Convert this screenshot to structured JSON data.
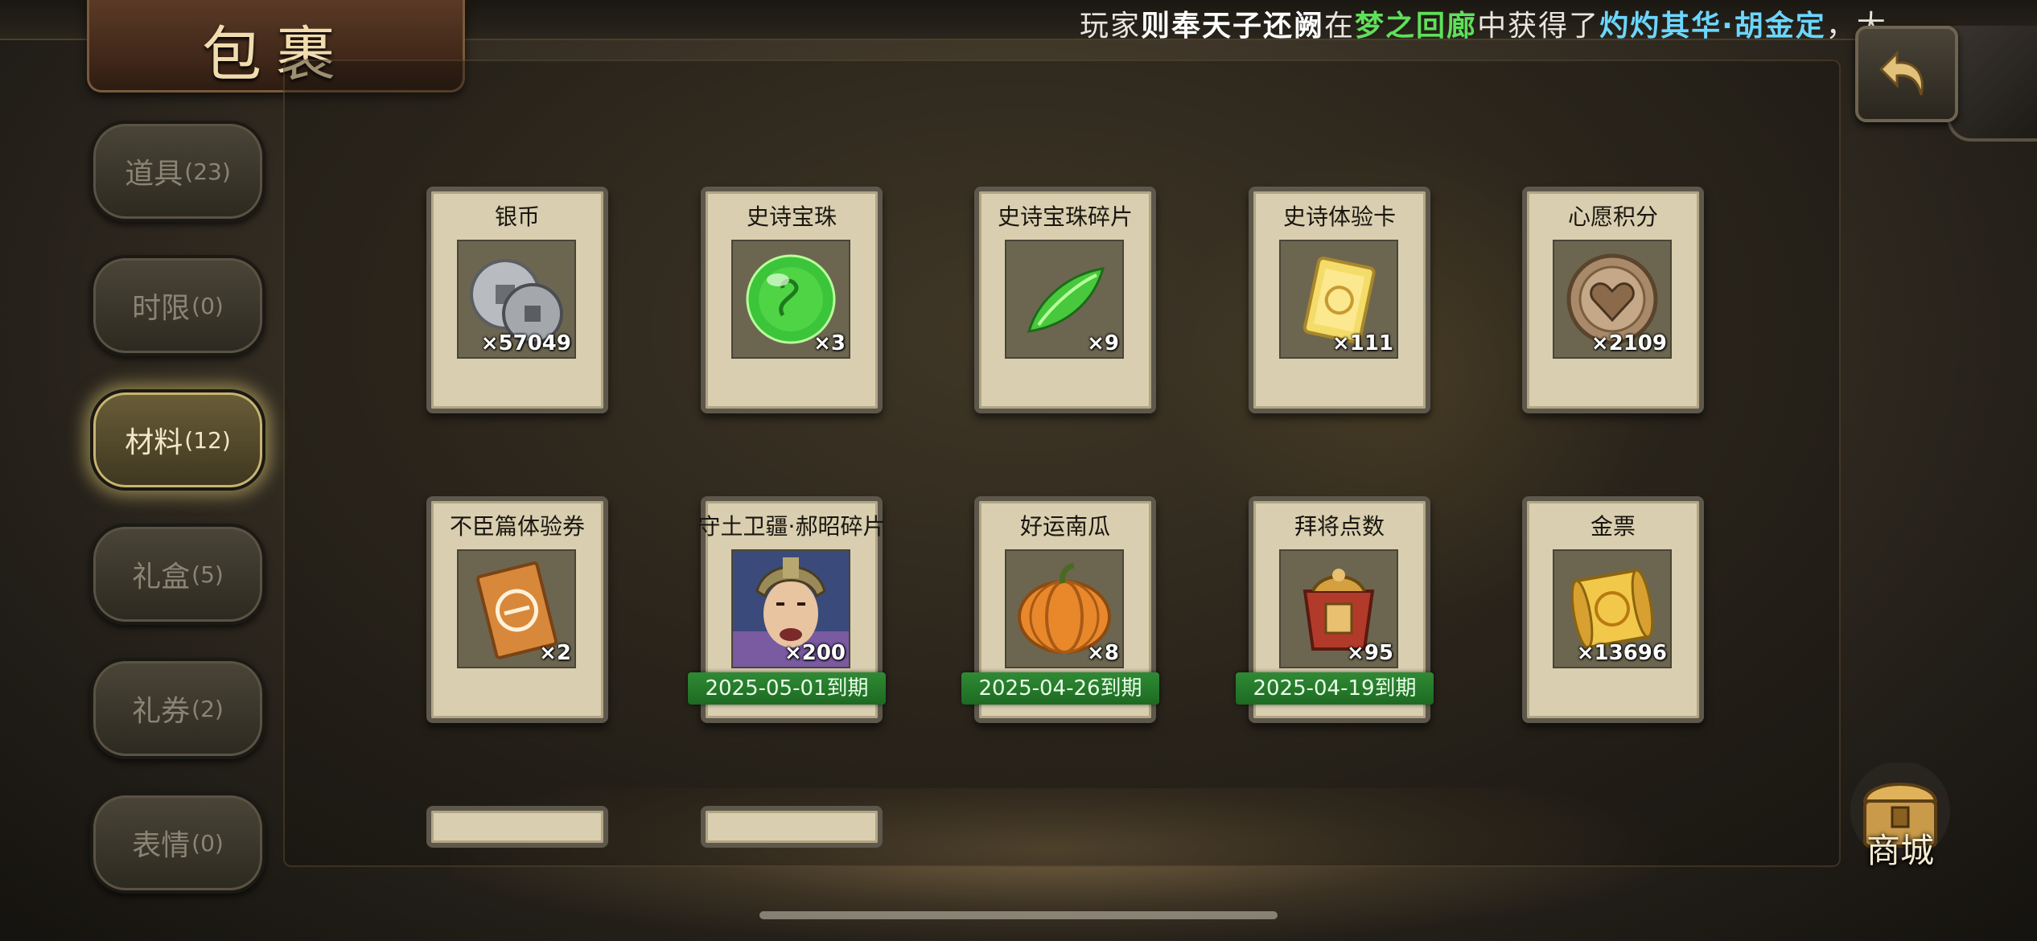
{
  "marquee": {
    "parts": [
      {
        "text": "玩家",
        "style": "plain"
      },
      {
        "text": "则奉天子还阙",
        "style": "player"
      },
      {
        "text": "在",
        "style": "plain"
      },
      {
        "text": "梦之回廊",
        "style": "location"
      },
      {
        "text": "中获得了",
        "style": "plain"
      },
      {
        "text": "灼灼其华·胡金定",
        "style": "item"
      },
      {
        "text": "，大",
        "style": "plain"
      }
    ]
  },
  "title": "包裹",
  "back_button_icon": "back-arrow-icon",
  "sidebar": {
    "tabs": [
      {
        "label": "道具",
        "count": "(23)",
        "active": false
      },
      {
        "label": "时限",
        "count": "(0)",
        "active": false
      },
      {
        "label": "材料",
        "count": "(12)",
        "active": true
      },
      {
        "label": "礼盒",
        "count": "(5)",
        "active": false
      },
      {
        "label": "礼券",
        "count": "(2)",
        "active": false
      },
      {
        "label": "表情",
        "count": "(0)",
        "active": false
      }
    ]
  },
  "items": [
    {
      "name": "银币",
      "qty": "×57049",
      "icon": "silver-coin-icon",
      "expiry": ""
    },
    {
      "name": "史诗宝珠",
      "qty": "×3",
      "icon": "green-orb-icon",
      "expiry": ""
    },
    {
      "name": "史诗宝珠碎片",
      "qty": "×9",
      "icon": "green-shard-icon",
      "expiry": ""
    },
    {
      "name": "史诗体验卡",
      "qty": "×111",
      "icon": "gold-card-icon",
      "expiry": ""
    },
    {
      "name": "心愿积分",
      "qty": "×2109",
      "icon": "heart-coin-icon",
      "expiry": ""
    },
    {
      "name": "不臣篇体验券",
      "qty": "×2",
      "icon": "orange-ticket-icon",
      "expiry": ""
    },
    {
      "name": "守土卫疆·郝昭碎片",
      "qty": "×200",
      "icon": "warrior-portrait-icon",
      "expiry": "2025-05-01到期"
    },
    {
      "name": "好运南瓜",
      "qty": "×8",
      "icon": "pumpkin-icon",
      "expiry": "2025-04-26到期"
    },
    {
      "name": "拜将点数",
      "qty": "×95",
      "icon": "red-pouch-icon",
      "expiry": "2025-04-19到期"
    },
    {
      "name": "金票",
      "qty": "×13696",
      "icon": "gold-scroll-icon",
      "expiry": ""
    }
  ],
  "shop": {
    "label": "商城",
    "icon": "shop-chest-icon"
  },
  "colors": {
    "player_highlight": "#ffffff",
    "location_highlight": "#5fe05a",
    "item_highlight": "#6cd6ff",
    "expiry_badge": "#2f8a34",
    "active_tab_glow": "#e6d278"
  }
}
